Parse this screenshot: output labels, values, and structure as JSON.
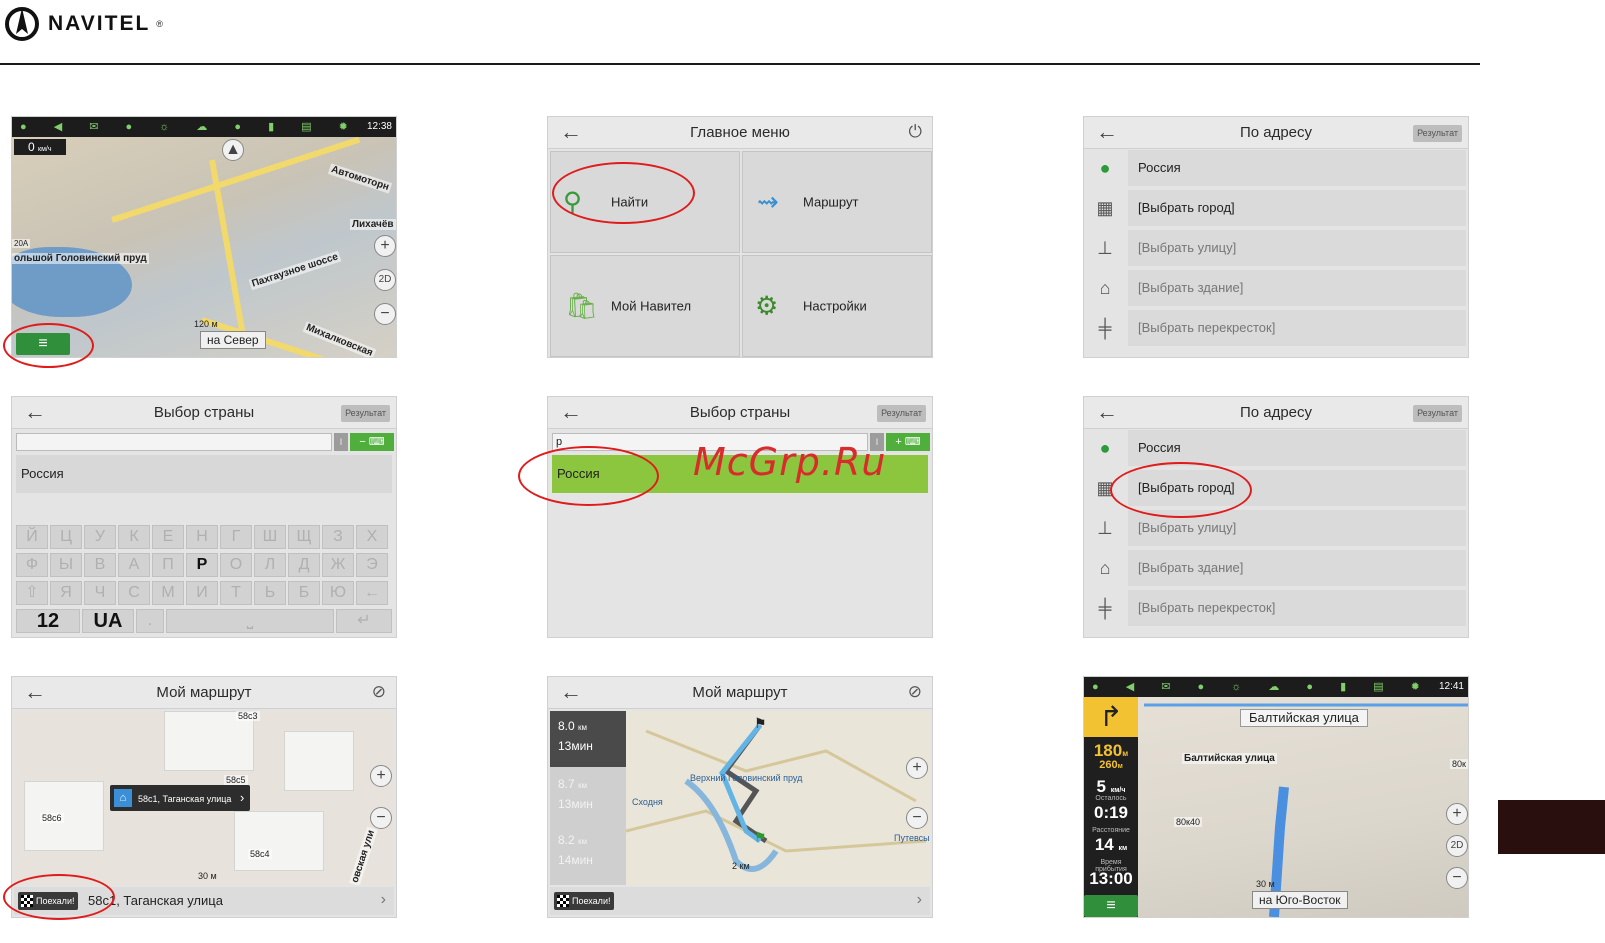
{
  "brand": {
    "name": "NAVITEL",
    "reg": "®"
  },
  "icons": [
    "navitel-logo-icon",
    "back-arrow-icon",
    "power-icon",
    "search-icon",
    "route-icon",
    "my-navitel-icon",
    "settings-gear-icon",
    "globe-icon",
    "city-icon",
    "street-icon",
    "building-icon",
    "crossroad-icon",
    "keyboard-icon",
    "home-icon",
    "finish-flag-icon",
    "route-off-icon",
    "zoom-in-icon",
    "zoom-out-icon",
    "compass-icon",
    "menu-icon"
  ],
  "screen1": {
    "time": "12:38",
    "speed": "0",
    "speed_unit": "км/ч",
    "labels": [
      "Автомоторн",
      "Лихачёв",
      "ольшой Головинский пруд",
      "Пахгаузное шоссе",
      "Михалковская",
      "20А"
    ],
    "scale": "120 м",
    "direction": "на Север",
    "view_2d": "2D"
  },
  "screen2": {
    "title": "Главное меню",
    "tiles": [
      "Найти",
      "Маршрут",
      "Мой Навител",
      "Настройки"
    ]
  },
  "screen3": {
    "title": "По адресу",
    "result_btn": "Результат",
    "rows": [
      "Россия",
      "[Выбрать город]",
      "[Выбрать улицу]",
      "[Выбрать здание]",
      "[Выбрать перекресток]"
    ]
  },
  "screen4": {
    "title": "Выбор страны",
    "result_btn": "Результат",
    "field_value": "",
    "sep": "I",
    "item": "Россия",
    "keys_row1": [
      "Й",
      "Ц",
      "У",
      "К",
      "Е",
      "Н",
      "Г",
      "Ш",
      "Щ",
      "З",
      "Х"
    ],
    "keys_row2": [
      "Ф",
      "Ы",
      "В",
      "А",
      "П",
      "Р",
      "О",
      "Л",
      "Д",
      "Ж",
      "Э"
    ],
    "keys_row3": [
      "⇧",
      "Я",
      "Ч",
      "С",
      "М",
      "И",
      "Т",
      "Ь",
      "Б",
      "Ю",
      "←"
    ],
    "key_num": "12",
    "key_lang": "UA",
    "key_dot": ".",
    "key_space": "⎵",
    "key_enter": "↵"
  },
  "screen5": {
    "title": "Выбор страны",
    "result_btn": "Результат",
    "field_value": "р",
    "sep": "I",
    "item": "Россия"
  },
  "screen6": {
    "title": "По адресу",
    "result_btn": "Результат",
    "rows": [
      "Россия",
      "[Выбрать город]",
      "[Выбрать улицу]",
      "[Выбрать здание]",
      "[Выбрать перекресток]"
    ]
  },
  "screen7": {
    "title": "Мой маршрут",
    "bubble": "58с1, Таганская улица",
    "map_labels": [
      "58с3",
      "58с5",
      "58с6",
      "58с4",
      "овская ули"
    ],
    "scale": "30 м",
    "go": "Поехали!",
    "address": "58с1, Таганская улица"
  },
  "screen8": {
    "title": "Мой маршрут",
    "routes": [
      {
        "dist": "8.0",
        "unit": "км",
        "time": "13мин"
      },
      {
        "dist": "8.7",
        "unit": "км",
        "time": "13мин"
      },
      {
        "dist": "8.2",
        "unit": "км",
        "time": "14мин"
      }
    ],
    "map_labels": [
      "Верхний Головинский пруд",
      "Сходня",
      "Путевсы"
    ],
    "scale": "2 км",
    "go": "Поехали!"
  },
  "screen9": {
    "time": "12:41",
    "street_top": "Балтийская улица",
    "street_map": "Балтийская улица",
    "dist1": "180",
    "dist1_unit": "м",
    "dist2": "260",
    "dist2_unit": "м",
    "speed": "5",
    "speed_unit": "км/ч",
    "remain_label": "Осталось",
    "remain_time": "0:19",
    "distance_label": "Расстояние",
    "distance": "14",
    "distance_unit": "км",
    "arrival_label": "Время прибытия",
    "arrival": "13:00",
    "scale": "30 м",
    "direction": "на Юго-Восток",
    "map_labels": [
      "80к40",
      "80к"
    ],
    "view_2d": "2D"
  },
  "watermark": "McGrp.Ru",
  "colors": {
    "accent_green": "#8cc63e",
    "menu_green": "#2f8f3a",
    "highlight_ring": "#e01b1b"
  }
}
